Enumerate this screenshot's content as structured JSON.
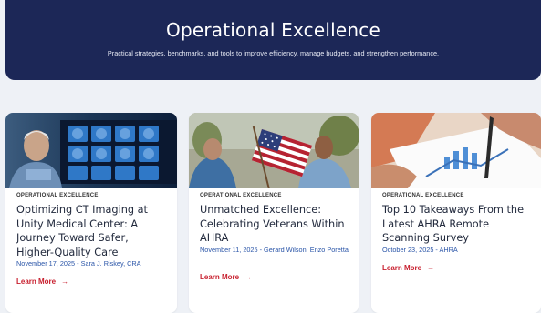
{
  "hero": {
    "title": "Operational Excellence",
    "subtitle": "Practical strategies, benchmarks, and tools to improve efficiency, manage budgets, and strengthen performance."
  },
  "cards": [
    {
      "category": "OPERATIONAL EXCELLENCE",
      "title": "Optimizing CT Imaging at Unity Medical Center: A Journey Toward Safer, Higher-Quality Care",
      "meta": "November 17, 2025 - Sara J. Riskey, CRA",
      "cta": "Learn More",
      "arrow": "→",
      "image": "ct-imaging-photo"
    },
    {
      "category": "OPERATIONAL EXCELLENCE",
      "title": "Unmatched Excellence: Celebrating Veterans Within AHRA",
      "meta": "November 11, 2025 - Gerard Wilson, Enzo Poretta",
      "cta": "Learn More",
      "arrow": "→",
      "image": "veterans-flag-photo"
    },
    {
      "category": "OPERATIONAL EXCELLENCE",
      "title": "Top 10 Takeaways From the Latest AHRA Remote Scanning Survey",
      "meta": "October 23, 2025 - AHRA",
      "cta": "Learn More",
      "arrow": "→",
      "image": "survey-chart-photo"
    }
  ],
  "colors": {
    "hero_bg": "#1c2757",
    "page_bg": "#eef1f6",
    "link_red": "#c8202f",
    "meta_blue": "#2a55a8"
  }
}
